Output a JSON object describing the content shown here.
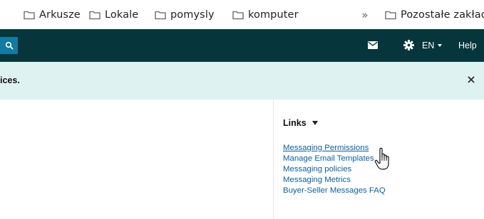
{
  "bookmarks_bar": {
    "items": [
      {
        "label": "Arkusze"
      },
      {
        "label": "Lokale"
      },
      {
        "label": "pomysly"
      },
      {
        "label": "komputer"
      }
    ],
    "overflow_chevron": "»",
    "other_bookmarks": "Pozostałe zakładki"
  },
  "header": {
    "icons": [
      "search-icon",
      "mail-icon",
      "gear-icon"
    ],
    "language": "EN",
    "help": "Help",
    "colors": {
      "background": "#06353b",
      "search_button": "#137aa1"
    }
  },
  "banner": {
    "text": "ices.",
    "close": "×",
    "background": "#dff2f2"
  },
  "sidebar": {
    "title": "Links",
    "links": [
      {
        "label": "Messaging Permissions"
      },
      {
        "label": "Manage Email Templates"
      },
      {
        "label": "Messaging policies"
      },
      {
        "label": "Messaging Metrics"
      },
      {
        "label": "Buyer-Seller Messages FAQ"
      }
    ],
    "link_color": "#0c5f9e"
  },
  "pointer": "hand-cursor"
}
